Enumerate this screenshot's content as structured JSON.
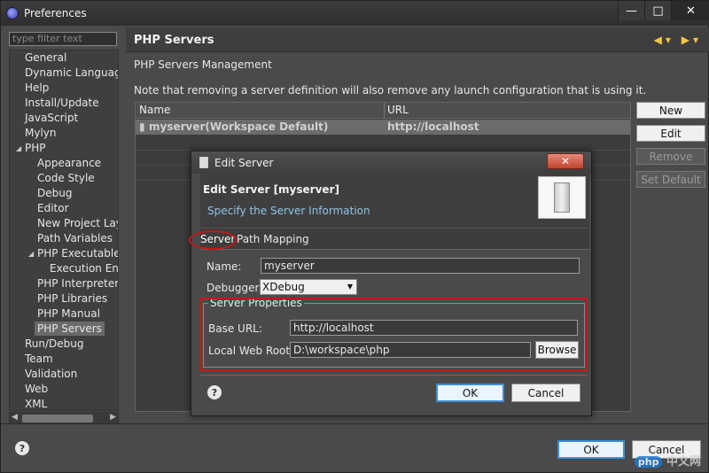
{
  "window": {
    "title": "Preferences",
    "controls": [
      "—",
      "□",
      "✕"
    ]
  },
  "sidebar": {
    "filter_placeholder": "type filter text",
    "items": [
      {
        "label": "General"
      },
      {
        "label": "Dynamic Languages"
      },
      {
        "label": "Help"
      },
      {
        "label": "Install/Update"
      },
      {
        "label": "JavaScript"
      },
      {
        "label": "Mylyn"
      },
      {
        "label": "PHP"
      },
      {
        "label": "Appearance"
      },
      {
        "label": "Code Style"
      },
      {
        "label": "Debug"
      },
      {
        "label": "Editor"
      },
      {
        "label": "New Project Layo"
      },
      {
        "label": "Path Variables"
      },
      {
        "label": "PHP Executables"
      },
      {
        "label": "Execution Envi"
      },
      {
        "label": "PHP Interpreter"
      },
      {
        "label": "PHP Libraries"
      },
      {
        "label": "PHP Manual"
      },
      {
        "label": "PHP Servers"
      },
      {
        "label": "Run/Debug"
      },
      {
        "label": "Team"
      },
      {
        "label": "Validation"
      },
      {
        "label": "Web"
      },
      {
        "label": "XML"
      }
    ],
    "selected": "PHP Servers"
  },
  "page": {
    "title": "PHP Servers",
    "section_title": "PHP Servers Management",
    "note": "Note that removing a server definition will also remove any launch configuration that is using it.",
    "table": {
      "columns": [
        "Name",
        "URL"
      ],
      "rows": [
        {
          "name": "myserver(Workspace Default)",
          "url": "http://localhost"
        }
      ]
    },
    "buttons": {
      "new": "New",
      "edit": "Edit",
      "remove": "Remove",
      "set_default": "Set Default"
    }
  },
  "footer": {
    "help": "?",
    "ok": "OK",
    "cancel": "Cancel"
  },
  "dialog": {
    "title": "Edit Server",
    "close": "✕",
    "heading": "Edit Server [myserver]",
    "subheading": "Specify the Server Information",
    "tabs": [
      "Server",
      "Path Mapping"
    ],
    "active_tab": "Server",
    "name_label": "Name:",
    "name_value": "myserver",
    "debugger_label": "Debugger:",
    "debugger_value": "XDebug",
    "group_label": "Server Properties",
    "base_url_label": "Base URL:",
    "base_url_value": "http://localhost",
    "web_root_label": "Local Web Root:",
    "web_root_value": "D:\\workspace\\php",
    "browse": "Browse",
    "help": "?",
    "ok": "OK",
    "cancel": "Cancel"
  },
  "watermark": {
    "badge": "php",
    "text": "中文网"
  },
  "colors": {
    "highlight": "#c71616",
    "link_text": "#8fc3e6",
    "selection": "#6b6b6b"
  }
}
